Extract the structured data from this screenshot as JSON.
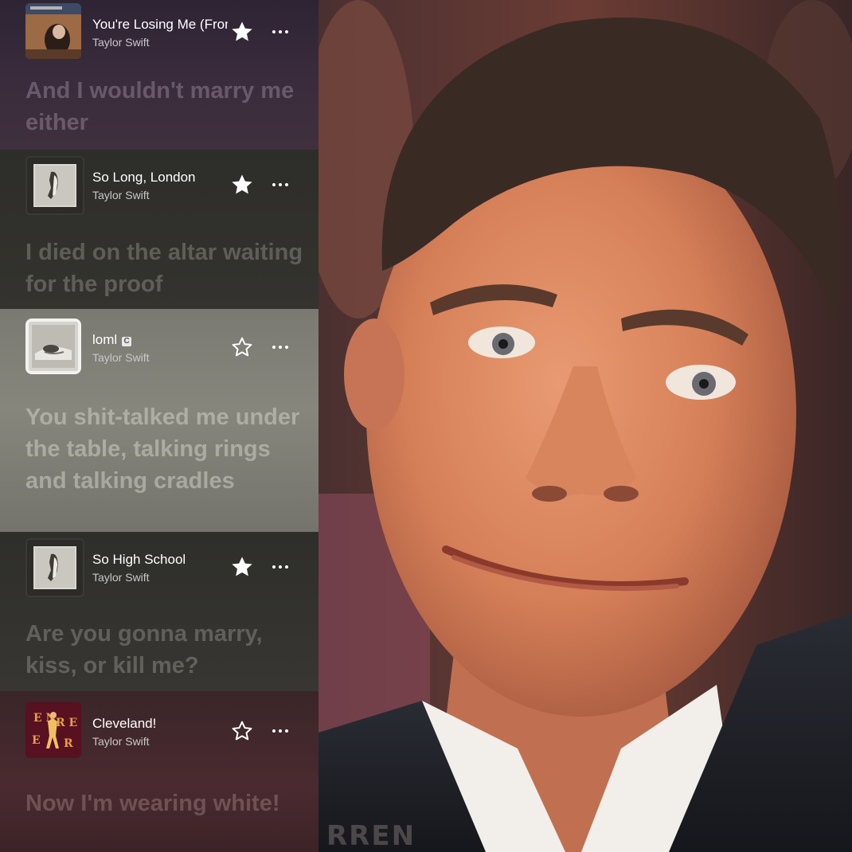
{
  "tracks": [
    {
      "title": "You're Losing Me (From The Vault)",
      "artist": "Taylor Swift",
      "favorite": true,
      "lyric": "And I wouldn't marry me either",
      "art_icon": "album-art-tortured-poets-icon"
    },
    {
      "title": "So Long, London",
      "artist": "Taylor Swift",
      "favorite": true,
      "lyric": "I died on the altar waiting for the proof",
      "art_icon": "album-art-ttpd-icon"
    },
    {
      "title": "loml",
      "artist": "Taylor Swift",
      "favorite": false,
      "clean_badge": "C",
      "lyric": "You shit-talked me under the table, talking rings and talking cradles",
      "art_icon": "album-art-ttpd-white-icon"
    },
    {
      "title": "So High School",
      "artist": "Taylor Swift",
      "favorite": true,
      "lyric": "Are you gonna marry, kiss, or kill me?",
      "art_icon": "album-art-ttpd-icon"
    },
    {
      "title": "Cleveland!",
      "artist": "Taylor Swift",
      "favorite": false,
      "lyric": "Now I'm wearing white!",
      "art_icon": "album-art-encore-icon"
    }
  ],
  "photo": {
    "caption_fragment": "RREN",
    "description_icon": "reaction-face-photo"
  },
  "colors": {
    "text": "#ffffff",
    "subtext": "#c8c8c8"
  }
}
